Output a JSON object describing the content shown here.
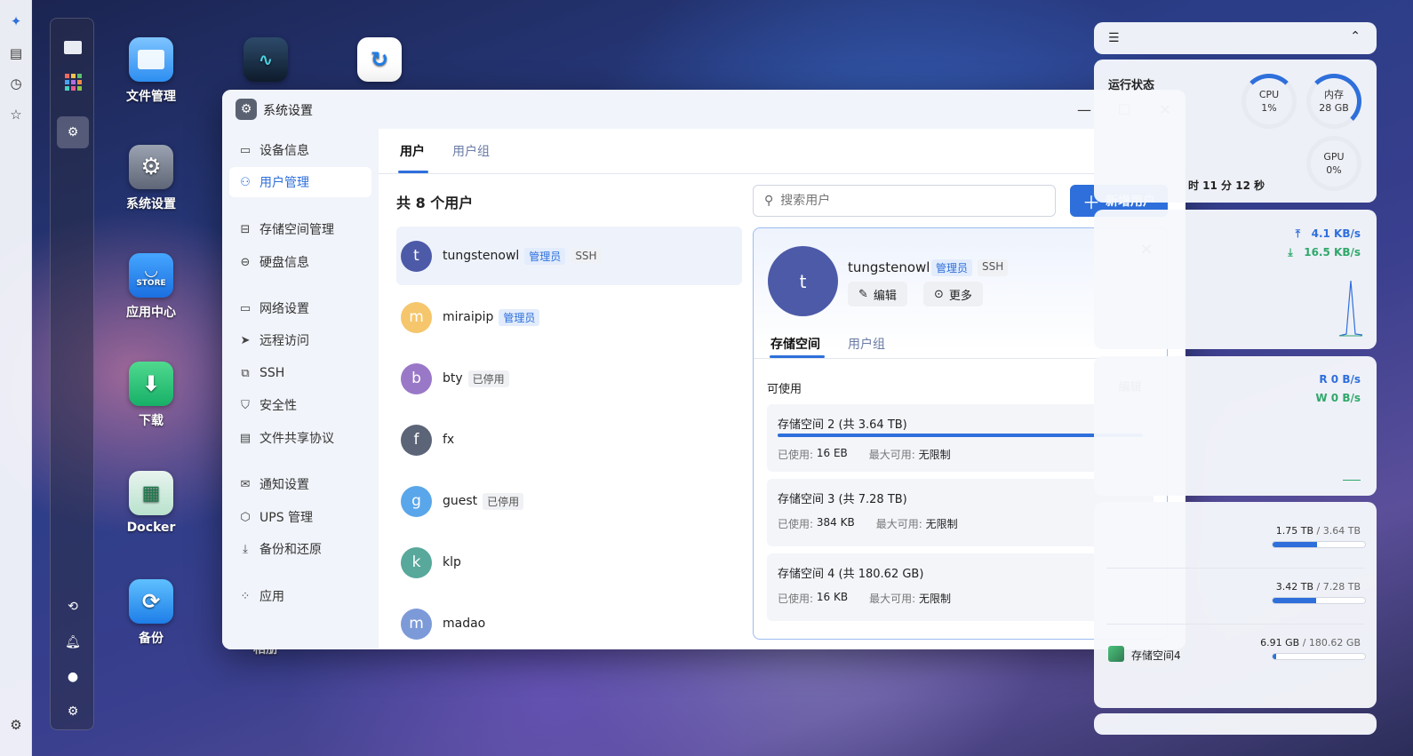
{
  "desktop": {
    "icons": [
      {
        "label": "文件管理"
      },
      {
        "label": "系统设置"
      },
      {
        "label": "应用中心",
        "badge": "STORE"
      },
      {
        "label": "下载"
      },
      {
        "label": "Docker"
      },
      {
        "label": "备份"
      }
    ],
    "partial_label": "相册"
  },
  "window": {
    "title": "系统设置",
    "sidebar": [
      {
        "label": "设备信息",
        "icon": "device-icon"
      },
      {
        "label": "用户管理",
        "icon": "user-icon",
        "active": true
      },
      {
        "label": "存储空间管理",
        "icon": "storage-icon"
      },
      {
        "label": "硬盘信息",
        "icon": "disk-icon"
      },
      {
        "label": "网络设置",
        "icon": "network-icon"
      },
      {
        "label": "远程访问",
        "icon": "send-icon"
      },
      {
        "label": "SSH",
        "icon": "terminal-icon"
      },
      {
        "label": "安全性",
        "icon": "shield-icon"
      },
      {
        "label": "文件共享协议",
        "icon": "file-icon"
      },
      {
        "label": "通知设置",
        "icon": "mail-icon"
      },
      {
        "label": "UPS 管理",
        "icon": "ups-icon"
      },
      {
        "label": "备份和还原",
        "icon": "backup-icon"
      },
      {
        "label": "应用",
        "icon": "apps-icon"
      }
    ],
    "tabs": [
      "用户",
      "用户组"
    ],
    "user_count_text": "共 8 个用户",
    "search_placeholder": "搜索用户",
    "add_user_label": "新增用户",
    "users": [
      {
        "initial": "t",
        "name": "tungstenowl",
        "badges": [
          "管理员",
          "SSH"
        ],
        "color": "#4c5aa8"
      },
      {
        "initial": "m",
        "name": "miraipip",
        "badges": [
          "管理员"
        ],
        "color": "#f5c66c"
      },
      {
        "initial": "b",
        "name": "bty",
        "badges": [
          "已停用"
        ],
        "color": "#9a78c8"
      },
      {
        "initial": "f",
        "name": "fx",
        "badges": [],
        "color": "#5c6478"
      },
      {
        "initial": "g",
        "name": "guest",
        "badges": [
          "已停用"
        ],
        "color": "#5aa6ea"
      },
      {
        "initial": "k",
        "name": "klp",
        "badges": [],
        "color": "#58a89c"
      },
      {
        "initial": "m",
        "name": "madao",
        "badges": [],
        "color": "#7d9ad8"
      }
    ],
    "detail": {
      "initial": "t",
      "name": "tungstenowl",
      "badges": [
        "管理员",
        "SSH"
      ],
      "edit_label": "编辑",
      "more_label": "更多",
      "tabs": [
        "存储空间",
        "用户组"
      ],
      "available_label": "可使用",
      "edit_button": "编辑",
      "used_label": "已使用:",
      "max_label": "最大可用:",
      "volumes": [
        {
          "title": "存储空间 2 (共 3.64 TB)",
          "used": "16 EB",
          "max": "无限制",
          "usage_fraction": 1.0
        },
        {
          "title": "存储空间 3 (共 7.28 TB)",
          "used": "384 KB",
          "max": "无限制",
          "usage_fraction": 0
        },
        {
          "title": "存储空间 4 (共 180.62 GB)",
          "used": "16 KB",
          "max": "无限制",
          "usage_fraction": 0
        }
      ]
    }
  },
  "widgets": {
    "status_title": "运行状态",
    "cpu": {
      "label": "CPU",
      "value": "1%"
    },
    "mem": {
      "label": "内存",
      "value": "28 GB"
    },
    "gpu": {
      "label": "GPU",
      "value": "0%"
    },
    "uptime_partial": "时 11 分 12 秒",
    "net": {
      "up": "4.1 KB/s",
      "down": "16.5 KB/s"
    },
    "disk_io": {
      "read": "R  0 B/s",
      "write": "W  0 B/s"
    },
    "storage": [
      {
        "name": "",
        "used": "1.75 TB",
        "total": "/ 3.64 TB",
        "fraction": 0.48
      },
      {
        "name": "",
        "used": "3.42 TB",
        "total": "/ 7.28 TB",
        "fraction": 0.47
      },
      {
        "name": "存储空间4",
        "used": "6.91 GB",
        "total": "/ 180.62 GB",
        "fraction": 0.04
      }
    ]
  }
}
